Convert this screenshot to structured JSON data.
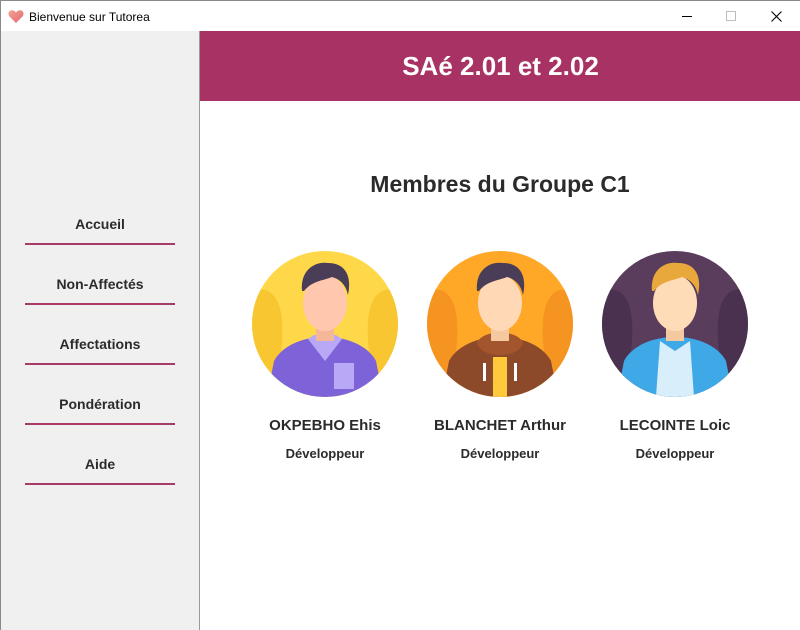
{
  "window": {
    "title": "Bienvenue sur Tutorea",
    "icon": "heart-icon"
  },
  "sidebar": {
    "items": [
      {
        "label": "Accueil"
      },
      {
        "label": "Non-Affectés"
      },
      {
        "label": "Affectations"
      },
      {
        "label": "Pondération"
      },
      {
        "label": "Aide"
      }
    ]
  },
  "header": {
    "title": "SAé 2.01 et 2.02"
  },
  "main": {
    "group_title": "Membres du Groupe C1",
    "members": [
      {
        "name": "OKPEBHO Ehis",
        "role": "Développeur",
        "avatar_bg": "#ffd84a"
      },
      {
        "name": "BLANCHET Arthur",
        "role": "Développeur",
        "avatar_bg": "#ffa726"
      },
      {
        "name": "LECOINTE Loic",
        "role": "Développeur",
        "avatar_bg": "#5a3d5c"
      }
    ]
  },
  "colors": {
    "accent": "#a83264",
    "sidebar_bg": "#f0f0f0",
    "nav_underline": "#a83a68"
  }
}
